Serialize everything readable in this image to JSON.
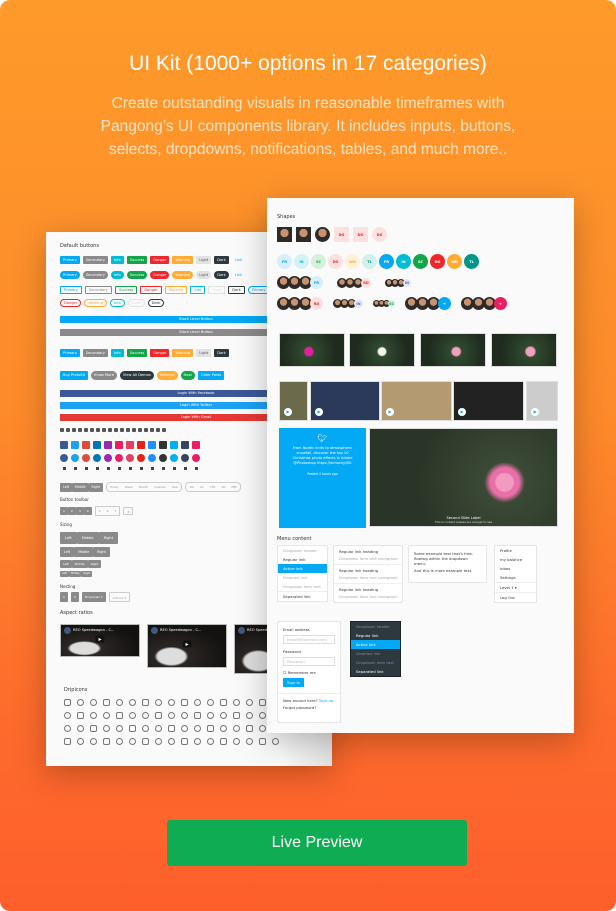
{
  "header": {
    "title": "UI Kit (1000+ options in 17 categories)",
    "subtitle": "Create outstanding visuals in reasonable timeframes with Pangong’s UI components library. It includes inputs, buttons, selects, dropdowns, notifications, tables, and much more.."
  },
  "colors": {
    "primary": "#03a9f4",
    "secondary": "#8a8a8a",
    "info": "#00bcd4",
    "success": "#13a54a",
    "danger": "#f0262b",
    "warning": "#ffab35",
    "light": "#e2e2e2",
    "dark": "#2e393f",
    "facebook": "#3b5998",
    "twitter": "#1da1f2",
    "gmail": "#e53935",
    "cta": "#0fac53"
  },
  "left_card": {
    "default_buttons_label": "Default buttons",
    "button_variants": [
      "Primary",
      "Secondary",
      "Info",
      "Success",
      "Danger",
      "Warning",
      "Light",
      "Dark",
      "Link"
    ],
    "outline_row": [
      "Primary",
      "Secondary",
      "Success",
      "Danger",
      "Warning",
      "Info",
      "Light",
      "Dark",
      "Primary",
      "Secondary"
    ],
    "outline_pill_row": [
      "Danger",
      "Warning",
      "Info",
      "Light",
      "Dark"
    ],
    "block_buttons": [
      "Block Level Button",
      "Block Level Button"
    ],
    "gradient_row": [
      "Primary",
      "Secondary",
      "Info",
      "Success",
      "Danger",
      "Warning",
      "Light",
      "Dark"
    ],
    "icon_buttons": [
      "Buy ProtoKit",
      "Know More",
      "View All Demos",
      "Settings",
      "Next",
      "Older Posts"
    ],
    "social_logins": [
      "Login With Facebook",
      "Login With Twitter",
      "Login With Gmail"
    ],
    "group_labels": [
      "Left",
      "Middle",
      "Right"
    ],
    "period_labels": [
      "Today",
      "Week",
      "Month",
      "Quarter",
      "Year"
    ],
    "range_labels": [
      "1M",
      "All",
      "YTD",
      "2K",
      "MM"
    ],
    "button_toolbar_label": "Button toolbar",
    "toolbar_numbers": [
      "1",
      "2",
      "3",
      "4",
      "5",
      "6",
      "7",
      "8"
    ],
    "sizing_label": "Sizing",
    "nesting_label": "Nesting",
    "nesting_items": [
      "1",
      "2",
      "Dropdown",
      "Actions"
    ],
    "aspect_label": "Aspect ratios",
    "video_title": "REO Speedwagon - C...",
    "dripicons_label": "Dripicons"
  },
  "right_card": {
    "shapes_label": "Shapes",
    "initials_row1": [
      "DG",
      "DG",
      "DG"
    ],
    "initials_row2": [
      "PR",
      "IN",
      "SC",
      "DG",
      "WN",
      "TL",
      "PR",
      "IN",
      "SC",
      "DG",
      "WN",
      "TL"
    ],
    "group_badges": [
      "PR",
      "RD",
      "IN",
      "RD",
      "IN",
      "SC",
      "+",
      "+"
    ],
    "tweet": {
      "text": "From Nordic knits to atmospheric snowfall, discover the top 10 Christmas photo effects in Adobe @Photoshop https://mmacky/BG",
      "time": "Posted 4 hours ago"
    },
    "slide": {
      "title": "Second Slide Label",
      "caption": "This is content passes are enough to see"
    },
    "menu_label": "Menu content",
    "dropdown1": [
      "Dropdown header",
      "Regular link",
      "Active link",
      "Disabled link",
      "Dropdown item text",
      "Separated link"
    ],
    "dropdown2": [
      {
        "heading": "Regular link heading",
        "text": "Dropdown item text paragraph"
      },
      {
        "heading": "Regular link heading",
        "text": "Dropdown item text paragraph"
      },
      {
        "heading": "Regular link heading",
        "text": "Dropdown item text paragraph"
      }
    ],
    "dropdown3": [
      "Some example text that's free-flowing within the dropdown menu.",
      "And this is more example text."
    ],
    "dropdown4": [
      "Profile",
      "my balance",
      "Inbox",
      "Settings",
      "Level 1 ▾",
      "Log Out"
    ],
    "form": {
      "email_label": "Email address",
      "email_placeholder": "email@example.com",
      "password_label": "Password",
      "password_placeholder": "Password",
      "remember": "Remember me",
      "submit": "Sign in",
      "new_here": "New around here?",
      "signup": "Sign up",
      "forgot": "Forgot password?"
    },
    "dark_dropdown": [
      "Dropdown header",
      "Regular link",
      "Active link",
      "Disabled link",
      "Dropdown item text",
      "Separated link"
    ]
  },
  "cta": {
    "label": "Live Preview"
  }
}
